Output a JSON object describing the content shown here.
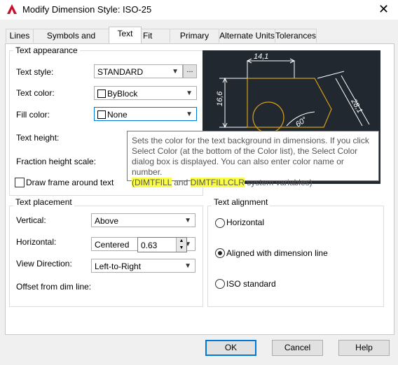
{
  "window": {
    "title": "Modify Dimension Style: ISO-25",
    "close_icon": "close-icon"
  },
  "tabs": [
    {
      "label": "Lines"
    },
    {
      "label": "Symbols and Arrows"
    },
    {
      "label": "Text",
      "active": true
    },
    {
      "label": "Fit"
    },
    {
      "label": "Primary Units"
    },
    {
      "label": "Alternate Units"
    },
    {
      "label": "Tolerances"
    }
  ],
  "text_appearance": {
    "title": "Text appearance",
    "text_style_label": "Text style:",
    "text_style_value": "STANDARD",
    "browse_label": "...",
    "text_color_label": "Text color:",
    "text_color_value": "ByBlock",
    "fill_color_label": "Fill color:",
    "fill_color_value": "None",
    "text_height_label": "Text height:",
    "fraction_height_label": "Fraction height scale:",
    "draw_frame_label": "Draw frame around text"
  },
  "preview": {
    "dim_top": "14,1",
    "dim_left": "16,6",
    "dim_diag": "28,1",
    "dim_angle": "60°"
  },
  "text_placement": {
    "title": "Text placement",
    "vertical_label": "Vertical:",
    "vertical_value": "Above",
    "horizontal_label": "Horizontal:",
    "horizontal_value": "Centered",
    "view_direction_label": "View Direction:",
    "view_direction_value": "Left-to-Right",
    "offset_label": "Offset from dim line:",
    "offset_value": "0.63"
  },
  "text_alignment": {
    "title": "Text alignment",
    "options": [
      "Horizontal",
      "Aligned with dimension line",
      "ISO standard"
    ],
    "selected": "Aligned with dimension line"
  },
  "tooltip": {
    "line1": "Sets the color for the text background in dimensions. If you click",
    "line2": "Select Color (at the bottom of the Color list), the Select Color",
    "line3": "dialog box is displayed. You can also enter color name or number.",
    "hl1": "(DIMTFILL",
    "mid": " and ",
    "hl2": "DIMTFILLCLR",
    "tail": " system variables)"
  },
  "buttons": {
    "ok": "OK",
    "cancel": "Cancel",
    "help": "Help"
  },
  "colors": {
    "accent": "#0078d7",
    "preview_bg": "#212830",
    "preview_shape": "#d4a017",
    "highlight": "#fafc4a"
  }
}
